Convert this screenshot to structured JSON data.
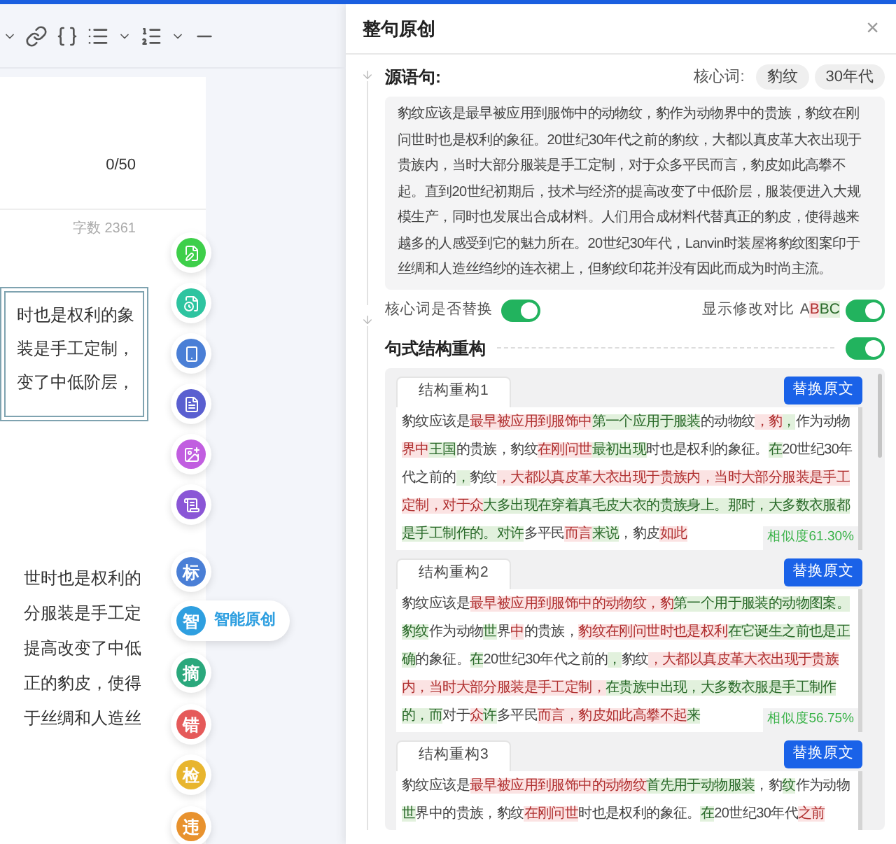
{
  "toolbar": {
    "items": [
      {
        "kind": "chevron"
      },
      {
        "kind": "link"
      },
      {
        "kind": "braces"
      },
      {
        "kind": "list"
      },
      {
        "kind": "chevron"
      },
      {
        "kind": "olist"
      },
      {
        "kind": "chevron"
      },
      {
        "kind": "rule"
      }
    ]
  },
  "editor": {
    "counter": "0/50",
    "word_count": "字数 2361",
    "quote_lines": [
      "时也是权利的象",
      "装是手工定制，",
      "变了中低阶层，"
    ],
    "body_lines": [
      "世时也是权利的",
      "分服装是手工定",
      "提高改变了中低",
      "正的豹皮，使得",
      "于丝绸和人造丝"
    ]
  },
  "side_tools": [
    {
      "kind": "icon",
      "color": "#3ecf4a",
      "expanded": false
    },
    {
      "kind": "icon",
      "color": "#2ec4a0",
      "expanded": false
    },
    {
      "kind": "icon",
      "color": "#4a7fd6",
      "expanded": false
    },
    {
      "kind": "icon",
      "color": "#5a5fd0",
      "expanded": false
    },
    {
      "kind": "icon",
      "color": "#c15ee0",
      "expanded": false
    },
    {
      "kind": "icon",
      "color": "#8a56d6",
      "expanded": false
    },
    {
      "kind": "char",
      "char": "标",
      "color": "#4a7fd6",
      "expanded": false
    },
    {
      "kind": "char",
      "char": "智",
      "color": "#2e9fe0",
      "expanded": true,
      "label": "智能原创"
    },
    {
      "kind": "char",
      "char": "摘",
      "color": "#2aa87c",
      "expanded": false
    },
    {
      "kind": "char",
      "char": "错",
      "color": "#e55a5a",
      "expanded": false
    },
    {
      "kind": "char",
      "char": "检",
      "color": "#e8b52e",
      "expanded": false
    },
    {
      "kind": "char",
      "char": "违",
      "color": "#e8922e",
      "expanded": false
    }
  ],
  "panel": {
    "title": "整句原创",
    "close": "×",
    "source": {
      "heading": "源语句:",
      "core_label": "核心词:",
      "core_words": [
        "豹纹",
        "30年代"
      ],
      "text": "豹纹应该是最早被应用到服饰中的动物纹，豹作为动物界中的贵族，豹纹在刚问世时也是权利的象征。20世纪30年代之前的豹纹，大都以真皮革大衣出现于贵族内，当时大部分服装是手工定制，对于众多平民而言，豹皮如此高攀不起。直到20世纪初期后，技术与经济的提高改变了中低阶层，服装便进入大规模生产，同时也发展出合成材料。人们用合成材料代替真正的豹皮，使得越来越多的人感受到它的魅力所在。20世纪30年代，Lanvin时装屋将豹纹图案印于丝绸和人造丝绉纱的连衣裙上，但豹纹印花并没有因此而成为时尚主流。",
      "replace_label": "核心词是否替换",
      "replace_on": true,
      "diff_label": "显示修改对比",
      "diff_sample": [
        {
          "t": "A",
          "kind": "same"
        },
        {
          "t": "B",
          "kind": "del"
        },
        {
          "t": "BC",
          "kind": "ins"
        }
      ],
      "diff_on": true
    },
    "restructure": {
      "heading": "句式结构重构",
      "on": true,
      "results": [
        {
          "tab": "结构重构1",
          "button": "替换原文",
          "similarity": "相似度61.30%",
          "segments": [
            {
              "t": "豹纹应该是",
              "kind": "same"
            },
            {
              "t": "最早被应用到服饰中",
              "kind": "del"
            },
            {
              "t": "第一个应用于服装",
              "kind": "ins"
            },
            {
              "t": "的动物纹",
              "kind": "same"
            },
            {
              "t": "，豹",
              "kind": "del"
            },
            {
              "t": "，",
              "kind": "ins"
            },
            {
              "t": "作为动物",
              "kind": "same"
            },
            {
              "t": "界中",
              "kind": "del"
            },
            {
              "t": "王国",
              "kind": "ins"
            },
            {
              "t": "的贵族，豹纹",
              "kind": "same"
            },
            {
              "t": "在刚问世",
              "kind": "del"
            },
            {
              "t": "最初出现",
              "kind": "ins"
            },
            {
              "t": "时也是权利的象征。",
              "kind": "same"
            },
            {
              "t": "在",
              "kind": "ins"
            },
            {
              "t": "20世纪30年代之前的",
              "kind": "same"
            },
            {
              "t": "，",
              "kind": "ins"
            },
            {
              "t": "豹纹",
              "kind": "same"
            },
            {
              "t": "，大都以真皮革大衣出现于贵族内，当时大部分服装是手工定制，对于众",
              "kind": "del"
            },
            {
              "t": "大多出现在穿着真毛皮大衣的贵族身上。那时，大多数衣服都是手工制作的。对许",
              "kind": "ins"
            },
            {
              "t": "多平民",
              "kind": "same"
            },
            {
              "t": "而言",
              "kind": "del"
            },
            {
              "t": "来说",
              "kind": "ins"
            },
            {
              "t": "，豹皮",
              "kind": "same"
            },
            {
              "t": "如此",
              "kind": "del"
            }
          ]
        },
        {
          "tab": "结构重构2",
          "button": "替换原文",
          "similarity": "相似度56.75%",
          "segments": [
            {
              "t": "豹纹应该是",
              "kind": "same"
            },
            {
              "t": "最早被应用到服饰中的动物纹，豹",
              "kind": "del"
            },
            {
              "t": "第一个用于服装的动物图案。豹纹",
              "kind": "ins"
            },
            {
              "t": "作为动物",
              "kind": "same"
            },
            {
              "t": "世",
              "kind": "ins"
            },
            {
              "t": "界",
              "kind": "same"
            },
            {
              "t": "中",
              "kind": "del"
            },
            {
              "t": "的贵族，",
              "kind": "same"
            },
            {
              "t": "豹纹在刚问世时也是权利",
              "kind": "del"
            },
            {
              "t": "在它诞生之前也是正确",
              "kind": "ins"
            },
            {
              "t": "的象征。",
              "kind": "same"
            },
            {
              "t": "在",
              "kind": "ins"
            },
            {
              "t": "20世纪30年代之前的",
              "kind": "same"
            },
            {
              "t": "，",
              "kind": "ins"
            },
            {
              "t": "豹纹",
              "kind": "same"
            },
            {
              "t": "，大都以真皮革大衣出现于贵族内，当时大部分服装是手工定制，",
              "kind": "del"
            },
            {
              "t": "在贵族中出现，大多数衣服是手工制作的，而",
              "kind": "ins"
            },
            {
              "t": "对于",
              "kind": "same"
            },
            {
              "t": "众",
              "kind": "del"
            },
            {
              "t": "许",
              "kind": "ins"
            },
            {
              "t": "多平民",
              "kind": "same"
            },
            {
              "t": "而言，豹皮如此高攀不起",
              "kind": "del"
            },
            {
              "t": "来",
              "kind": "ins"
            }
          ]
        },
        {
          "tab": "结构重构3",
          "button": "替换原文",
          "segments": [
            {
              "t": "豹纹应该是",
              "kind": "same"
            },
            {
              "t": "最早被应用到服饰中的动物纹",
              "kind": "del"
            },
            {
              "t": "首先用于动物服装",
              "kind": "ins"
            },
            {
              "t": "，豹",
              "kind": "same"
            },
            {
              "t": "纹",
              "kind": "ins"
            },
            {
              "t": "作为动物",
              "kind": "same"
            },
            {
              "t": "世",
              "kind": "ins"
            },
            {
              "t": "界中的贵族，豹纹",
              "kind": "same"
            },
            {
              "t": "在刚问世",
              "kind": "del"
            },
            {
              "t": "时也是权利的象征。",
              "kind": "same"
            },
            {
              "t": "在",
              "kind": "ins"
            },
            {
              "t": "20世纪30年代",
              "kind": "same"
            },
            {
              "t": "之前",
              "kind": "del"
            }
          ]
        }
      ]
    }
  }
}
